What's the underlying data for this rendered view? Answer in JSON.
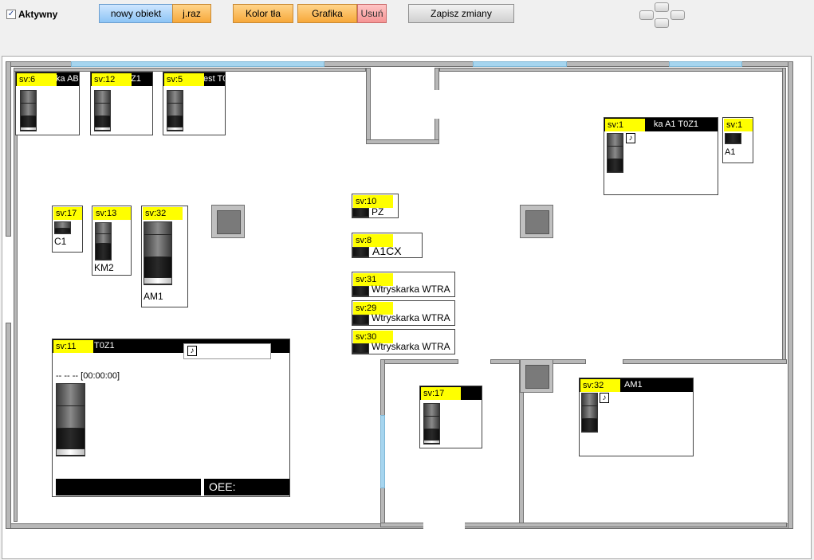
{
  "toolbar": {
    "active_checkbox": {
      "label": "Aktywny",
      "checked": true,
      "glyph": "✓"
    },
    "buttons": {
      "new_object": "nowy obiekt",
      "unit": "j.raz",
      "bg_color": "Kolor tła",
      "graphics": "Grafika",
      "delete": "Usuń",
      "save": "Zapisz zmiany"
    },
    "colors": {
      "blue": "#8cc4f5",
      "orange": "#f7a83a",
      "red": "#f59494",
      "status_yellow": "#ffff00"
    }
  },
  "machines": {
    "m1": {
      "sv": "sv:6",
      "title": "ka ABC"
    },
    "m2": {
      "sv": "sv:12",
      "title": "Z1"
    },
    "m3": {
      "sv": "sv:5",
      "title": "est T0"
    },
    "c1": {
      "sv": "sv:17",
      "label": "C1"
    },
    "km2": {
      "sv": "sv:13",
      "label": "KM2"
    },
    "am1": {
      "sv": "sv:32",
      "label": "AM1"
    },
    "pz": {
      "sv": "sv:10",
      "label": "PZ"
    },
    "a1cx": {
      "sv": "sv:8",
      "label": "A1CX"
    },
    "wtra1": {
      "sv": "sv:31",
      "label": "Wtryskarka WTRA"
    },
    "wtra2": {
      "sv": "sv:29",
      "label": "Wtryskarka WTRA"
    },
    "wtra3": {
      "sv": "sv:30",
      "label": "Wtryskarka WTRA"
    },
    "big": {
      "sv": "sv:11",
      "title": "T0Z1",
      "time": "-- -- --  [00:00:00]",
      "oee": "OEE:",
      "doc_glyph": "♪"
    },
    "a1_big": {
      "sv": "sv:1",
      "title": "ka A1  T0Z1",
      "doc_glyph": "♪"
    },
    "a1_small": {
      "sv": "sv:1",
      "label": "A1"
    },
    "mid17": {
      "sv": "sv:17"
    },
    "am1_right": {
      "sv": "sv:32",
      "title": "AM1",
      "doc_glyph": "♪"
    }
  }
}
